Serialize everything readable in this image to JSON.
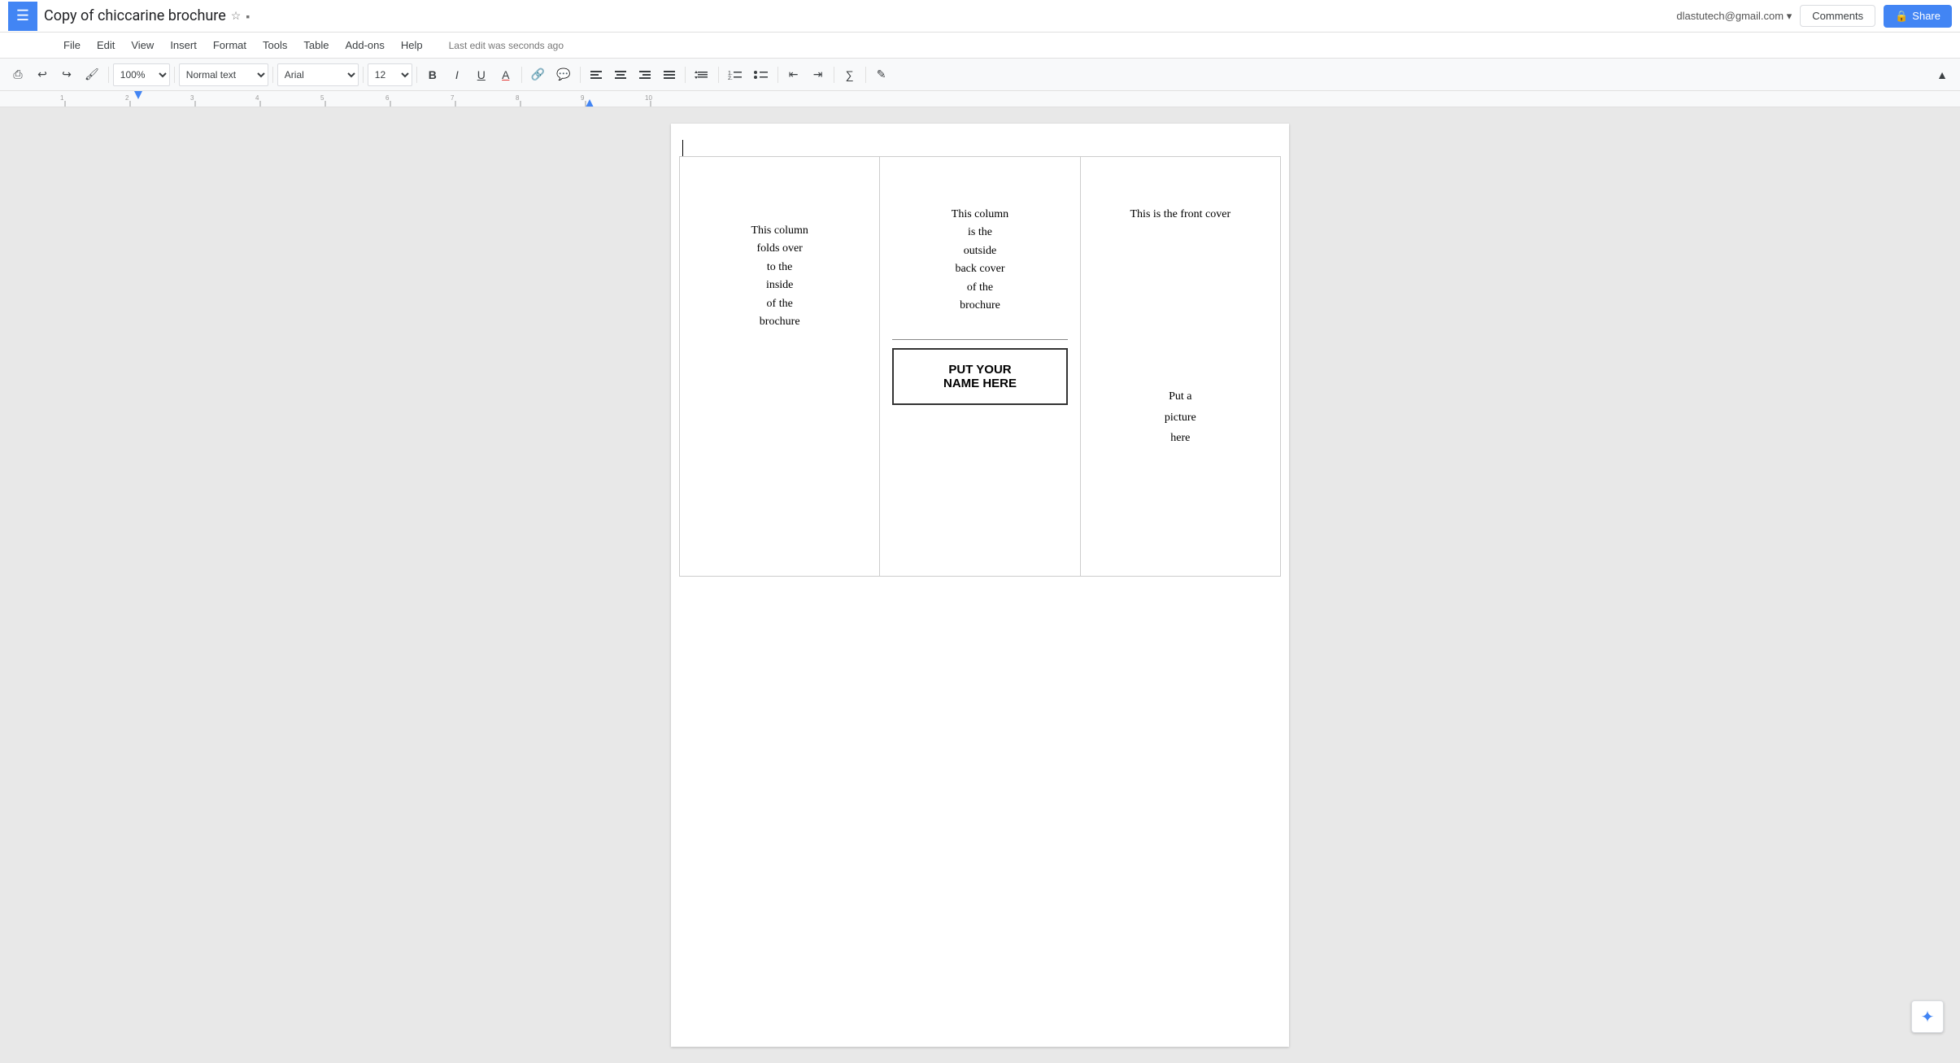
{
  "topbar": {
    "app_menu_icon": "☰",
    "doc_title": "Copy of chiccarine brochure",
    "star_icon": "☆",
    "folder_icon": "▪",
    "user_email": "dlastutech@gmail.com",
    "user_dropdown_icon": "▾",
    "comments_label": "Comments",
    "share_label": "Share",
    "share_lock_icon": "🔒"
  },
  "menubar": {
    "items": [
      "File",
      "Edit",
      "View",
      "Insert",
      "Format",
      "Tools",
      "Table",
      "Add-ons",
      "Help"
    ],
    "last_edit": "Last edit was seconds ago"
  },
  "toolbar": {
    "print_icon": "⎙",
    "undo_icon": "↩",
    "redo_icon": "↪",
    "paintformat_icon": "🖌",
    "zoom_value": "100%",
    "zoom_suffix": "▾",
    "style_value": "Normal text",
    "style_suffix": "▾",
    "font_value": "Arial",
    "font_suffix": "▾",
    "size_value": "12",
    "size_suffix": "▾",
    "bold_label": "B",
    "italic_label": "I",
    "underline_label": "U",
    "textcolor_label": "A",
    "link_icon": "🔗",
    "comment_icon": "💬",
    "align_left": "≡",
    "align_center": "≡",
    "align_right": "≡",
    "align_justify": "≡",
    "linespacing_icon": "≡",
    "numberedlist_icon": "≡",
    "bulletlist_icon": "≡",
    "decreaseindent_icon": "⇤",
    "increaseindent_icon": "⇥",
    "formula_icon": "∑",
    "draw_icon": "✎",
    "collapse_icon": "▲"
  },
  "document": {
    "cursor_visible": true,
    "brochure": {
      "col1": {
        "text_line1": "This column",
        "text_line2": "folds over",
        "text_line3": "to the",
        "text_line4": "inside",
        "text_line5": "of the",
        "text_line6": "brochure"
      },
      "col2": {
        "top_line1": "This column",
        "top_line2": "is the",
        "top_line3": "outside",
        "top_line4": "back cover",
        "top_line5": "of the",
        "top_line6": "brochure",
        "name_line1": "PUT YOUR",
        "name_line2": "NAME HERE"
      },
      "col3": {
        "front_cover": "This is the front cover",
        "picture_line1": "Put a",
        "picture_line2": "picture",
        "picture_line3": "here"
      }
    }
  },
  "assistant": {
    "icon": "✦"
  }
}
